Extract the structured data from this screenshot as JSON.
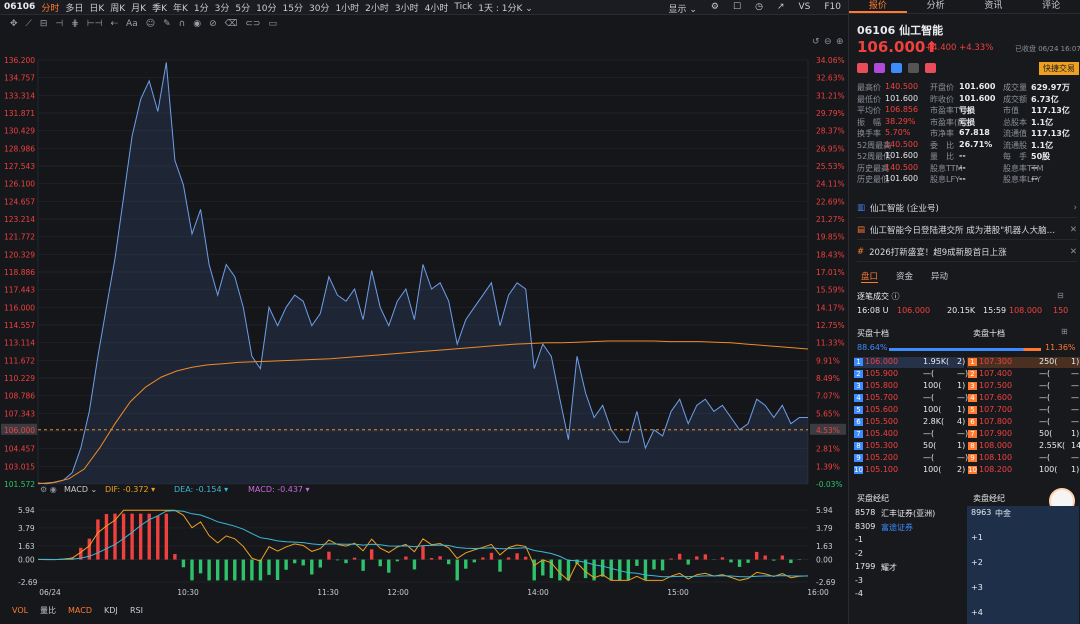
{
  "topbar": {
    "code": "06106",
    "tabs": [
      "分时",
      "多日",
      "日K",
      "周K",
      "月K",
      "季K",
      "年K",
      "1分",
      "3分",
      "5分",
      "10分",
      "15分",
      "30分",
      "1小时",
      "2小时",
      "3小时",
      "4小时",
      "Tick",
      "1天 : 1分K ⌄"
    ],
    "active": "分时",
    "display": "显示 ⌄",
    "vs": "VS",
    "f10": "F10"
  },
  "colors": {
    "up": "#f0413f",
    "down": "#2ec26b",
    "price_line": "#6f9ee8",
    "avg_line": "#f08a24",
    "accent": "#ff7a2f"
  },
  "chart_data": [
    {
      "type": "line",
      "title": "",
      "x_labels": [
        "06/24",
        "10:30",
        "11:30",
        "12:00",
        "14:00",
        "15:00",
        "16:00"
      ],
      "y_labels_left": [
        "136.200",
        "134.757",
        "133.314",
        "131.871",
        "130.429",
        "128.986",
        "127.543",
        "126.100",
        "124.657",
        "123.214",
        "121.772",
        "120.329",
        "118.886",
        "117.443",
        "116.000",
        "114.557",
        "113.114",
        "111.672",
        "110.229",
        "108.786",
        "107.343",
        "106.000",
        "104.457",
        "103.015",
        "101.572"
      ],
      "y_labels_right": [
        "34.06%",
        "32.63%",
        "31.21%",
        "29.79%",
        "28.37%",
        "26.95%",
        "25.53%",
        "24.11%",
        "22.69%",
        "21.27%",
        "19.85%",
        "18.43%",
        "17.01%",
        "15.59%",
        "14.17%",
        "12.75%",
        "11.33%",
        "9.91%",
        "8.49%",
        "7.07%",
        "5.65%",
        "4.53%",
        "2.81%",
        "1.39%",
        "-0.03%"
      ],
      "ylim": [
        101.572,
        136.2
      ],
      "current_price": "106.000",
      "current_pct": "4.53%",
      "series": [
        {
          "values": [
            101.65,
            101.6,
            101.7,
            101.9,
            102.5,
            104.5,
            107.5,
            112,
            116,
            120,
            125,
            130,
            133,
            134.5,
            132,
            136,
            128,
            126,
            122,
            124,
            119.5,
            117,
            119.5,
            118.5,
            116,
            112,
            111,
            116,
            114.5,
            116,
            117,
            116.5,
            114.5,
            115.5,
            118.5,
            117,
            116.5,
            117.5,
            115,
            119,
            116,
            114.5,
            116.5,
            117.5,
            115,
            119.5,
            117.5,
            118,
            116.5,
            113,
            115,
            116,
            117,
            118,
            114.5,
            117,
            118,
            117.5,
            111,
            113,
            112,
            108.5,
            105.2,
            112,
            109,
            107,
            108,
            106,
            105,
            105,
            107.5,
            104.5,
            106,
            105.5,
            107.5,
            108.5,
            106.5,
            108,
            108.5,
            107.5,
            108,
            107,
            106,
            106.5,
            108.5,
            108,
            107,
            108,
            106.5,
            107,
            107
          ]
        },
        {
          "values": [
            101.6,
            101.7,
            102,
            102.8,
            104.5,
            106.5,
            108.3,
            109.5,
            110.3,
            110.8,
            111.1,
            111.3,
            111.4,
            111.5,
            111.55,
            111.6,
            111.65,
            111.7,
            111.75,
            111.8,
            111.9,
            112,
            112.1,
            112.2,
            112.3,
            112.4,
            112.5,
            112.6,
            112.7,
            112.8,
            112.9,
            113,
            113.05,
            113.1,
            113.1,
            113.15,
            113.2,
            113.25,
            113.25,
            113.25,
            113.25,
            113.2,
            113.2,
            113.2,
            113.15,
            113.1,
            113,
            112.9,
            112.8,
            112.7,
            112.6
          ]
        }
      ]
    },
    {
      "type": "bar",
      "title": "MACD",
      "dif": "-0.372",
      "dea": "-0.154",
      "macd": "-0.437",
      "y_labels": [
        "5.94",
        "3.79",
        "1.63",
        "0.00",
        "-2.69"
      ],
      "ylim": [
        -2.69,
        5.94
      ]
    }
  ],
  "bottom_tabs": [
    "VOL",
    "量比",
    "MACD",
    "KDJ",
    "RSI"
  ],
  "panel": {
    "tabs": [
      "报价",
      "分析",
      "资讯",
      "评论"
    ],
    "code": "06106",
    "name": "仙工智能",
    "price": "106.000",
    "change": "+4.400",
    "pct": "+4.33%",
    "date": "已收盘 06/24 16:07",
    "quick_trade": "快捷交易",
    "stats": [
      [
        "最高价",
        "140.500",
        "开盘价",
        "101.600",
        "成交量",
        "629.97万"
      ],
      [
        "最低价",
        "101.600",
        "昨收价",
        "101.600",
        "成交额",
        "6.73亿"
      ],
      [
        "平均价",
        "106.856",
        "市盈率TTM",
        "亏损",
        "市值",
        "117.13亿"
      ],
      [
        "振　幅",
        "38.29%",
        "市盈率(静)",
        "亏损",
        "总股本",
        "1.1亿"
      ],
      [
        "换手率",
        "5.70%",
        "市净率",
        "67.818",
        "流通值",
        "117.13亿"
      ],
      [
        "52周最高",
        "140.500",
        "委　比",
        "26.71%",
        "流通股",
        "1.1亿"
      ],
      [
        "52周最低",
        "101.600",
        "量　比",
        "--",
        "每　手",
        "50股"
      ],
      [
        "历史最高",
        "140.500",
        "股息TTM",
        "--",
        "股息率TTM",
        "--"
      ],
      [
        "历史最低",
        "101.600",
        "股息LFY",
        "--",
        "股息率LFY",
        "--"
      ]
    ],
    "news": [
      "仙工智能 (企业号)",
      "仙工智能今日登陆港交所 成为港股\"机器人大脑第...",
      "2026打新盛宴！超9成新股首日上涨"
    ],
    "sub_tabs": [
      "盘口",
      "资金",
      "异动"
    ],
    "trade_title": "逐笔成交",
    "last_trade": [
      "16:08 U",
      "106.000",
      "20.15K",
      "15:59",
      "108.000",
      "150"
    ],
    "bid_title": "买盘十档",
    "ask_title": "卖盘十档",
    "bid_pct": "88.64%",
    "ask_pct": "11.36%",
    "bids": [
      [
        "1",
        "106.000",
        "1.95K(",
        "2)"
      ],
      [
        "2",
        "105.900",
        "—(",
        "—)"
      ],
      [
        "3",
        "105.800",
        "100(",
        "1)"
      ],
      [
        "4",
        "105.700",
        "—(",
        "—)"
      ],
      [
        "5",
        "105.600",
        "100(",
        "1)"
      ],
      [
        "6",
        "105.500",
        "2.8K(",
        "4)"
      ],
      [
        "7",
        "105.400",
        "—(",
        "—)"
      ],
      [
        "8",
        "105.300",
        "50(",
        "1)"
      ],
      [
        "9",
        "105.200",
        "—(",
        "—)"
      ],
      [
        "10",
        "105.100",
        "100(",
        "2)"
      ]
    ],
    "asks": [
      [
        "1",
        "107.300",
        "250(",
        "1)"
      ],
      [
        "2",
        "107.400",
        "—(",
        "—"
      ],
      [
        "3",
        "107.500",
        "—(",
        "—"
      ],
      [
        "4",
        "107.600",
        "—(",
        "—"
      ],
      [
        "5",
        "107.700",
        "—(",
        "—"
      ],
      [
        "6",
        "107.800",
        "—(",
        "—"
      ],
      [
        "7",
        "107.900",
        "50(",
        "1)"
      ],
      [
        "8",
        "108.000",
        "2.55K(",
        "14)"
      ],
      [
        "9",
        "108.100",
        "—(",
        "—"
      ],
      [
        "10",
        "108.200",
        "100(",
        "1)"
      ]
    ],
    "broker_bid_title": "买盘经纪",
    "broker_ask_title": "卖盘经纪",
    "broker_bid": [
      [
        "8578",
        "汇丰证券(亚洲)"
      ],
      [
        "8309",
        "富途证券"
      ],
      [
        "-1",
        ""
      ],
      [
        "-2",
        ""
      ],
      [
        "1799",
        "耀才"
      ],
      [
        "-3",
        ""
      ],
      [
        "-4",
        ""
      ]
    ],
    "broker_ask": [
      [
        "8963",
        "中金"
      ],
      [
        "+1",
        ""
      ],
      [
        "+2",
        ""
      ],
      [
        "+3",
        ""
      ],
      [
        "+4",
        ""
      ]
    ]
  }
}
